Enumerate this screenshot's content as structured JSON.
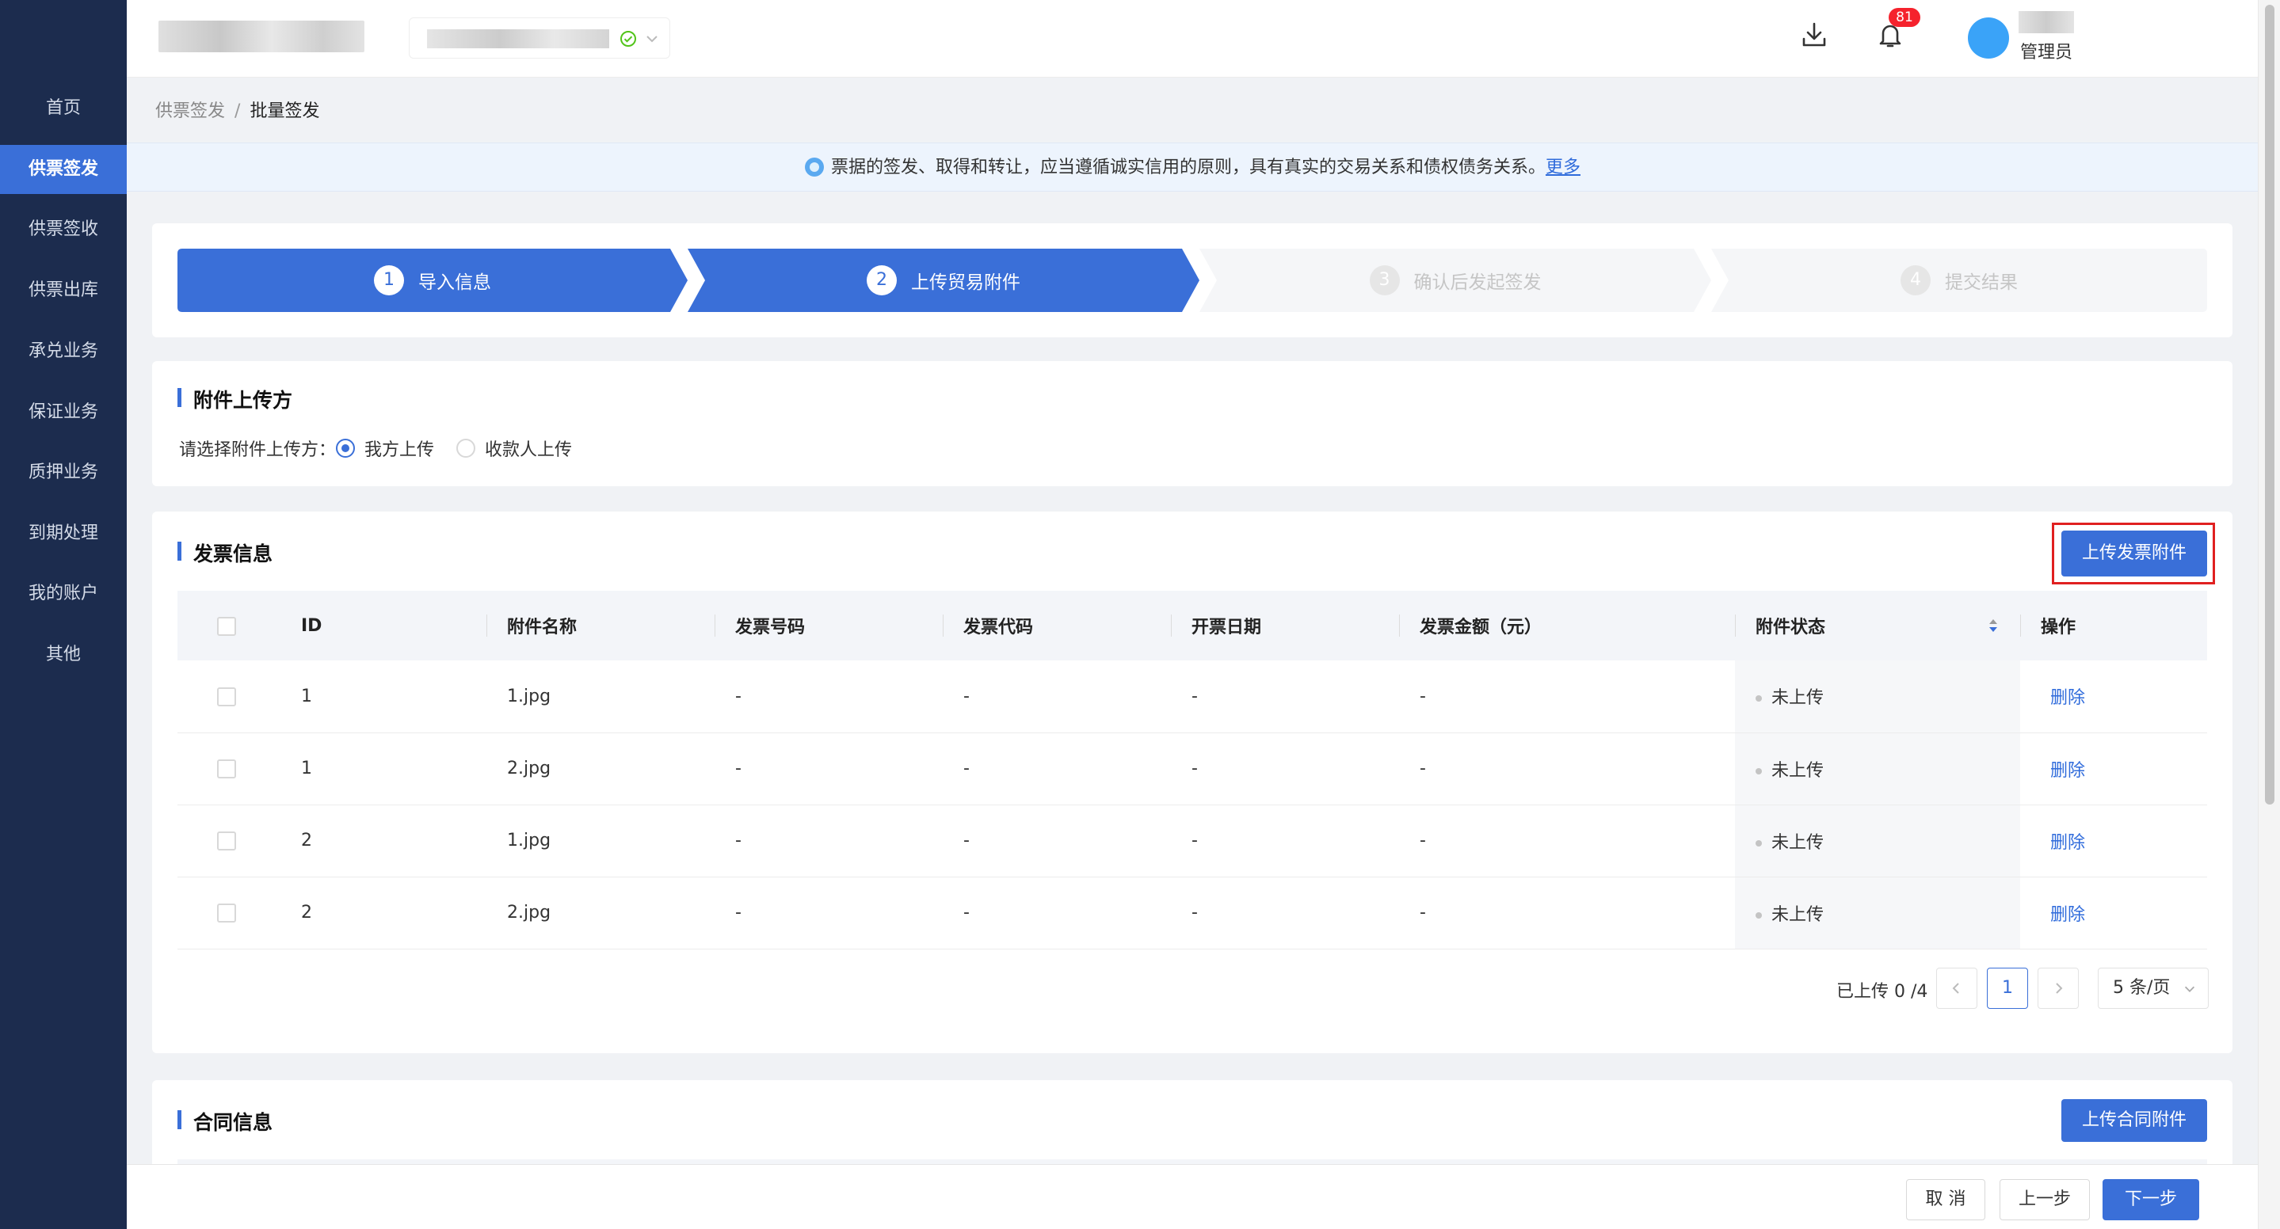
{
  "sidebar": {
    "items": [
      {
        "label": "首页",
        "active": false
      },
      {
        "label": "供票签发",
        "active": true
      },
      {
        "label": "供票签收",
        "active": false
      },
      {
        "label": "供票出库",
        "active": false
      },
      {
        "label": "承兑业务",
        "active": false
      },
      {
        "label": "保证业务",
        "active": false
      },
      {
        "label": "质押业务",
        "active": false
      },
      {
        "label": "到期处理",
        "active": false
      },
      {
        "label": "我的账户",
        "active": false
      },
      {
        "label": "其他",
        "active": false
      }
    ]
  },
  "header": {
    "notification_count": "81",
    "user_role": "管理员"
  },
  "breadcrumb": {
    "parent": "供票签发",
    "separator": "/",
    "current": "批量签发"
  },
  "notice": {
    "text": "票据的签发、取得和转让，应当遵循诚实信用的原则，具有真实的交易关系和债权债务关系。",
    "link": "更多"
  },
  "steps": [
    {
      "num": "1",
      "label": "导入信息",
      "status": "done"
    },
    {
      "num": "2",
      "label": "上传贸易附件",
      "status": "done"
    },
    {
      "num": "3",
      "label": "确认后发起签发",
      "status": "todo"
    },
    {
      "num": "4",
      "label": "提交结果",
      "status": "todo"
    }
  ],
  "uploader": {
    "title": "附件上传方",
    "prompt": "请选择附件上传方：",
    "options": [
      {
        "label": "我方上传",
        "checked": true
      },
      {
        "label": "收款人上传",
        "checked": false
      }
    ]
  },
  "invoice": {
    "title": "发票信息",
    "upload_button": "上传发票附件",
    "columns": [
      "ID",
      "附件名称",
      "发票号码",
      "发票代码",
      "开票日期",
      "发票金额（元）",
      "附件状态",
      "操作"
    ],
    "rows": [
      {
        "id": "1",
        "name": "1.jpg",
        "number": "-",
        "code": "-",
        "date": "-",
        "amount": "-",
        "status": "未上传",
        "action": "删除"
      },
      {
        "id": "1",
        "name": "2.jpg",
        "number": "-",
        "code": "-",
        "date": "-",
        "amount": "-",
        "status": "未上传",
        "action": "删除"
      },
      {
        "id": "2",
        "name": "1.jpg",
        "number": "-",
        "code": "-",
        "date": "-",
        "amount": "-",
        "status": "未上传",
        "action": "删除"
      },
      {
        "id": "2",
        "name": "2.jpg",
        "number": "-",
        "code": "-",
        "date": "-",
        "amount": "-",
        "status": "未上传",
        "action": "删除"
      }
    ],
    "pagination": {
      "summary": "已上传 0 /4",
      "current_page": "1",
      "page_size": "5 条/页"
    }
  },
  "contract": {
    "title": "合同信息",
    "upload_button": "上传合同附件"
  },
  "footer": {
    "cancel": "取 消",
    "prev": "上一步",
    "next": "下一步"
  },
  "colors": {
    "sidebar_bg": "#1c2c4e",
    "primary": "#3a6fd8",
    "highlight": "#e02020"
  }
}
